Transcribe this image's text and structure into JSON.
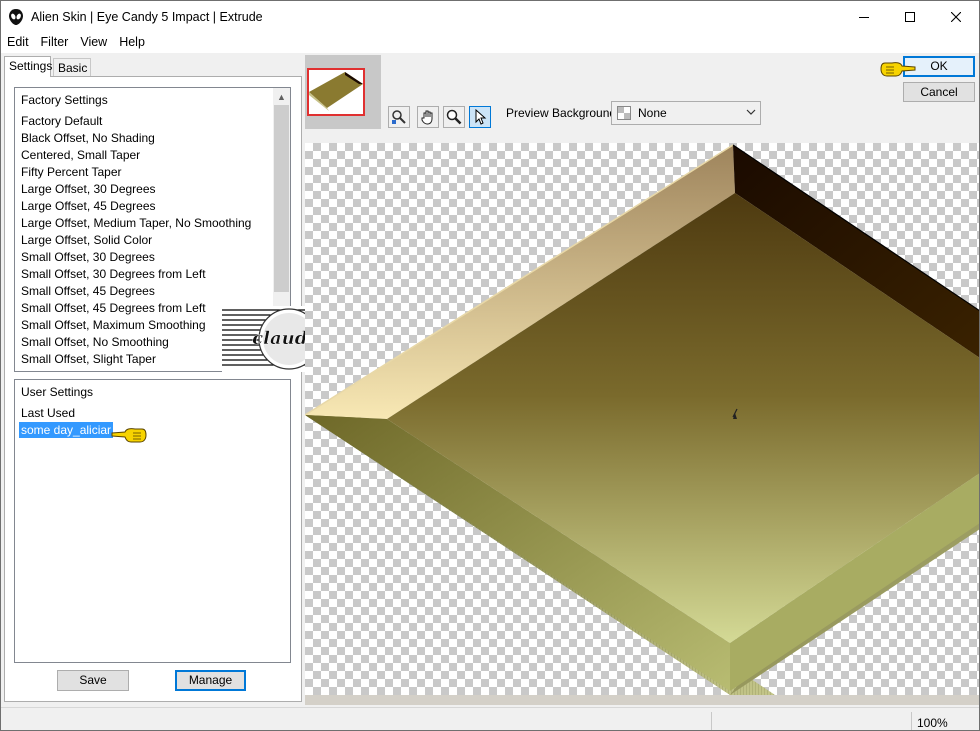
{
  "window": {
    "title": "Alien Skin | Eye Candy 5 Impact | Extrude"
  },
  "menu": [
    "Edit",
    "Filter",
    "View",
    "Help"
  ],
  "tabs": {
    "settings": "Settings",
    "basic": "Basic"
  },
  "factory_settings": {
    "header": "Factory Settings",
    "items": [
      "Factory Default",
      "Black Offset, No Shading",
      "Centered, Small Taper",
      "Fifty Percent Taper",
      "Large Offset, 30 Degrees",
      "Large Offset, 45 Degrees",
      "Large Offset, Medium Taper, No Smoothing",
      "Large Offset, Solid Color",
      "Small Offset, 30 Degrees",
      "Small Offset, 30 Degrees from Left",
      "Small Offset, 45 Degrees",
      "Small Offset, 45 Degrees from Left",
      "Small Offset, Maximum Smoothing",
      "Small Offset, No Smoothing",
      "Small Offset, Slight Taper"
    ]
  },
  "user_settings": {
    "header": "User Settings",
    "items": [
      "Last Used",
      "some day_aliciar"
    ],
    "selected": "some day_aliciar"
  },
  "buttons": {
    "save": "Save",
    "manage": "Manage",
    "ok": "OK",
    "cancel": "Cancel"
  },
  "preview_background": {
    "label": "Preview Background:",
    "value": "None"
  },
  "status": {
    "zoom": "100%"
  },
  "watermark": {
    "text": "claudia"
  },
  "icons": {
    "app": "alien-head-icon",
    "tools": [
      "pan-zoom-icon",
      "hand-icon",
      "zoom-icon",
      "arrow-pointer-icon"
    ],
    "hint": "pointing-hand-icon"
  },
  "colors": {
    "accent": "#0078d7",
    "selection": "#3399ff",
    "extrude_light": "#f5e6b0",
    "extrude_dark": "#1a0a00",
    "face_top": "#5a4514",
    "face_bottom": "#c8d08a"
  }
}
